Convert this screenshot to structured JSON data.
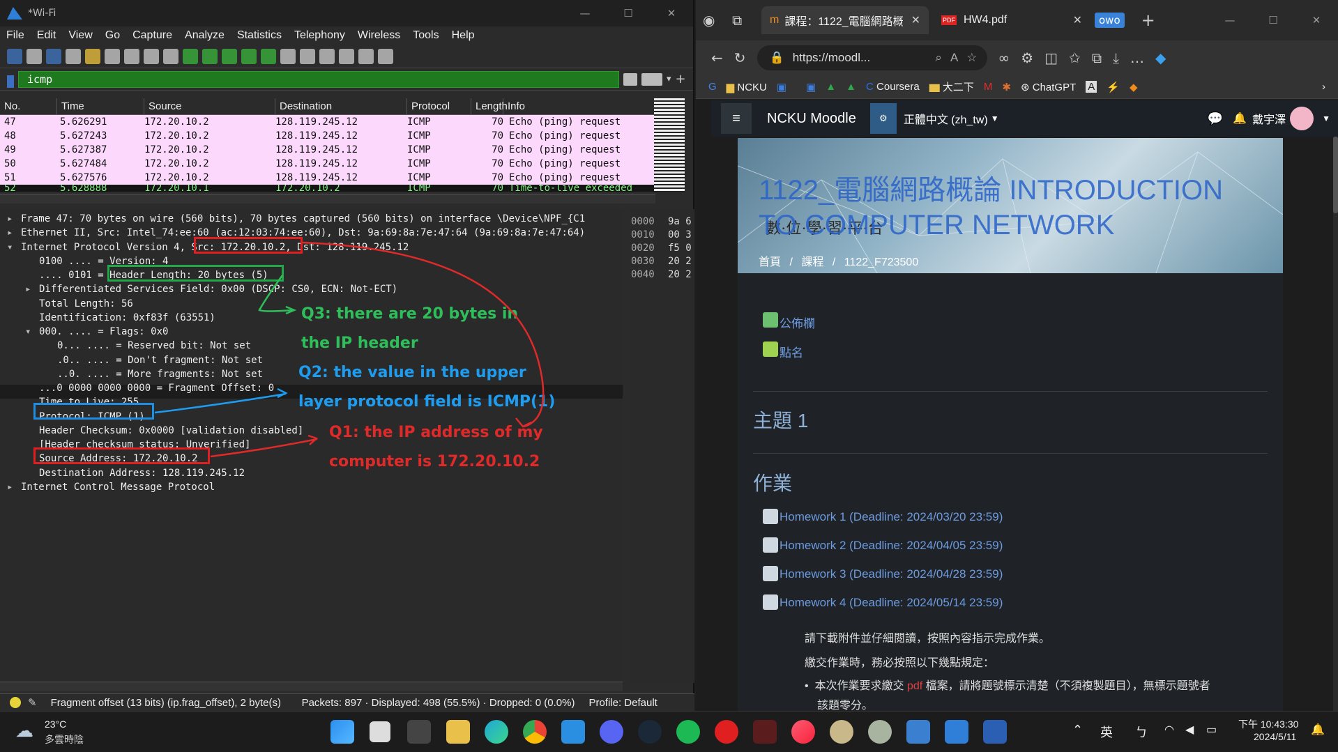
{
  "wireshark": {
    "title": "*Wi-Fi",
    "menu": [
      "File",
      "Edit",
      "View",
      "Go",
      "Capture",
      "Analyze",
      "Statistics",
      "Telephony",
      "Wireless",
      "Tools",
      "Help"
    ],
    "filter": "icmp",
    "columns": [
      "No.",
      "Time",
      "Source",
      "Destination",
      "Protocol",
      "Length",
      "Info"
    ],
    "packets": [
      {
        "no": "47",
        "time": "5.626291",
        "src": "172.20.10.2",
        "dst": "128.119.245.12",
        "proto": "ICMP",
        "len": "70",
        "info": "Echo (ping) request"
      },
      {
        "no": "48",
        "time": "5.627243",
        "src": "172.20.10.2",
        "dst": "128.119.245.12",
        "proto": "ICMP",
        "len": "70",
        "info": "Echo (ping) request"
      },
      {
        "no": "49",
        "time": "5.627387",
        "src": "172.20.10.2",
        "dst": "128.119.245.12",
        "proto": "ICMP",
        "len": "70",
        "info": "Echo (ping) request"
      },
      {
        "no": "50",
        "time": "5.627484",
        "src": "172.20.10.2",
        "dst": "128.119.245.12",
        "proto": "ICMP",
        "len": "70",
        "info": "Echo (ping) request"
      },
      {
        "no": "51",
        "time": "5.627576",
        "src": "172.20.10.2",
        "dst": "128.119.245.12",
        "proto": "ICMP",
        "len": "70",
        "info": "Echo (ping) request"
      },
      {
        "no": "52",
        "time": "5.628888",
        "src": "172.20.10.1",
        "dst": "172.20.10.2",
        "proto": "ICMP",
        "len": "70",
        "info": "Time-to-live exceeded"
      }
    ],
    "detail": [
      "Frame 47: 70 bytes on wire (560 bits), 70 bytes captured (560 bits) on interface \\Device\\NPF_{C1",
      "Ethernet II, Src: Intel_74:ee:60 (ac:12:03:74:ee:60), Dst: 9a:69:8a:7e:47:64 (9a:69:8a:7e:47:64)",
      "Internet Protocol Version 4, Src: 172.20.10.2, Dst: 128.119.245.12",
      "0100 .... = Version: 4",
      ".... 0101 = Header Length: 20 bytes (5)",
      "Differentiated Services Field: 0x00 (DSCP: CS0, ECN: Not-ECT)",
      "Total Length: 56",
      "Identification: 0xf83f (63551)",
      "000. .... = Flags: 0x0",
      "0... .... = Reserved bit: Not set",
      ".0.. .... = Don't fragment: Not set",
      "..0. .... = More fragments: Not set",
      "...0 0000 0000 0000 = Fragment Offset: 0",
      "Time to Live: 255",
      "Protocol: ICMP (1)",
      "Header Checksum: 0x0000 [validation disabled]",
      "[Header checksum status: Unverified]",
      "Source Address: 172.20.10.2",
      "Destination Address: 128.119.245.12",
      "Internet Control Message Protocol"
    ],
    "hex_offsets": [
      "0000",
      "0010",
      "0020",
      "0030",
      "0040"
    ],
    "hex_bytes": [
      "9a 6",
      "00 3",
      "f5 0",
      "20 2",
      "20 2"
    ],
    "annotations": {
      "q3": [
        "Q3: there are 20 bytes in",
        "the IP header"
      ],
      "q2": [
        "Q2: the value in the upper",
        "layer protocol field is ICMP(1)"
      ],
      "q1": [
        "Q1: the IP address of my",
        "computer is 172.20.10.2"
      ]
    },
    "status": {
      "field": "Fragment offset (13 bits) (ip.frag_offset), 2 byte(s)",
      "packets": "Packets: 897 · Displayed: 498 (55.5%) · Dropped: 0 (0.0%)",
      "profile": "Profile: Default"
    }
  },
  "browser": {
    "tab1": "課程：1122_電腦網路概",
    "tab2": "HW4.pdf",
    "profile_badge": "owo",
    "url": "https://moodl...",
    "bookmarks": [
      "NCKU",
      "Coursera",
      "大二下",
      "ChatGPT"
    ],
    "moodle": {
      "site": "NCKU Moodle",
      "lang": "正體中文 (zh_tw)",
      "user": "戴宇澤",
      "course_title": "1122_電腦網路概論 INTRODUCTION TO COMPUTER NETWORK",
      "banner_caption": "數·位·學·習·平·台",
      "breadcrumb": [
        "首頁",
        "課程",
        "1122_F723500"
      ],
      "links": [
        "公佈欄",
        "點名"
      ],
      "section1": "主題 1",
      "section2": "作業",
      "homeworks": [
        "Homework 1 (Deadline: 2024/03/20 23:59)",
        "Homework 2 (Deadline: 2024/04/05 23:59)",
        "Homework 3 (Deadline: 2024/04/28 23:59)",
        "Homework 4 (Deadline: 2024/05/14 23:59)"
      ],
      "p1": "請下載附件並仔細閱讀，按照內容指示完成作業。",
      "p2": "繳交作業時，務必按照以下幾點規定：",
      "bullet_pre": "本次作業要求繳交 ",
      "bullet_pdf": "pdf",
      "bullet_post": " 檔案，請將題號標示清楚（不須複製題目），無標示題號者",
      "bullet_cont": "該題零分。"
    }
  },
  "taskbar": {
    "weather_temp": "23°C",
    "weather_desc": "多雲時陰",
    "ime": "英",
    "time": "下午 10:43:30",
    "date": "2024/5/11"
  }
}
